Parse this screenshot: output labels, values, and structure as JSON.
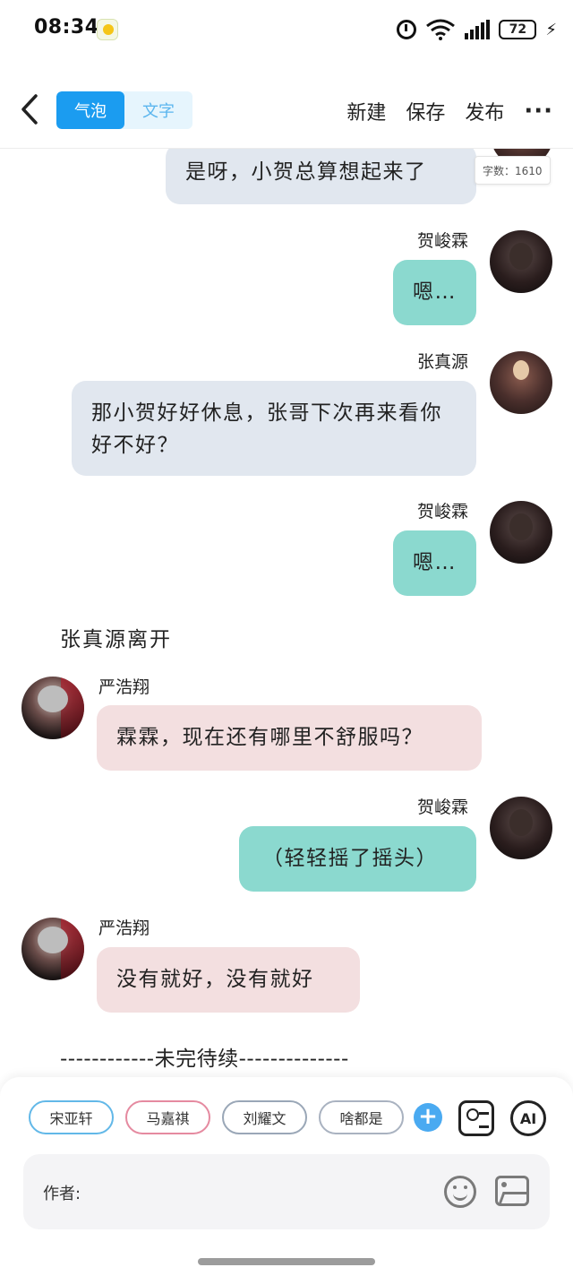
{
  "status_bar": {
    "time": "08:34",
    "battery": "72",
    "icons": [
      "app-notification-icon",
      "alarm-icon",
      "wifi-6-icon",
      "signal-icon",
      "battery-icon",
      "charging-icon"
    ]
  },
  "toolbar": {
    "back_icon": "chevron-left-icon",
    "mode_tabs": [
      "气泡",
      "文字"
    ],
    "active_mode": "气泡",
    "actions": [
      "新建",
      "保存",
      "发布"
    ],
    "more_icon": "more-horizontal-icon"
  },
  "chat": {
    "word_count_label": "字数：1610",
    "messages": [
      {
        "speaker": "",
        "side": "right",
        "style": "grey",
        "text": "是呀，小贺总算想起来了"
      },
      {
        "speaker": "贺峻霖",
        "side": "right",
        "style": "teal",
        "text": "嗯…"
      },
      {
        "speaker": "张真源",
        "side": "right",
        "style": "grey",
        "text": "那小贺好好休息，张哥下次再来看你好不好？"
      },
      {
        "speaker": "贺峻霖",
        "side": "right",
        "style": "teal",
        "text": "嗯…"
      },
      {
        "narration": "张真源离开"
      },
      {
        "speaker": "严浩翔",
        "side": "left",
        "style": "pink",
        "text": "霖霖，现在还有哪里不舒服吗？"
      },
      {
        "speaker": "贺峻霖",
        "side": "right",
        "style": "teal",
        "text": "（轻轻摇了摇头）"
      },
      {
        "speaker": "严浩翔",
        "side": "left",
        "style": "pink",
        "text": "没有就好，没有就好"
      },
      {
        "narration": "------------未完待续--------------"
      }
    ]
  },
  "bottom_panel": {
    "characters": [
      "宋亚轩",
      "马嘉祺",
      "刘耀文",
      "啥都是"
    ],
    "add_icon": "plus-icon",
    "role_card_icon": "role-card-icon",
    "ai_label": "AI",
    "input_label": "作者:",
    "input_icons": [
      "emoji-icon",
      "image-icon"
    ]
  },
  "colors": {
    "accent_blue": "#1b9cf0",
    "bubble_grey": "#e1e7ef",
    "bubble_teal": "#8bd9cf",
    "bubble_pink": "#f3dfe0"
  }
}
